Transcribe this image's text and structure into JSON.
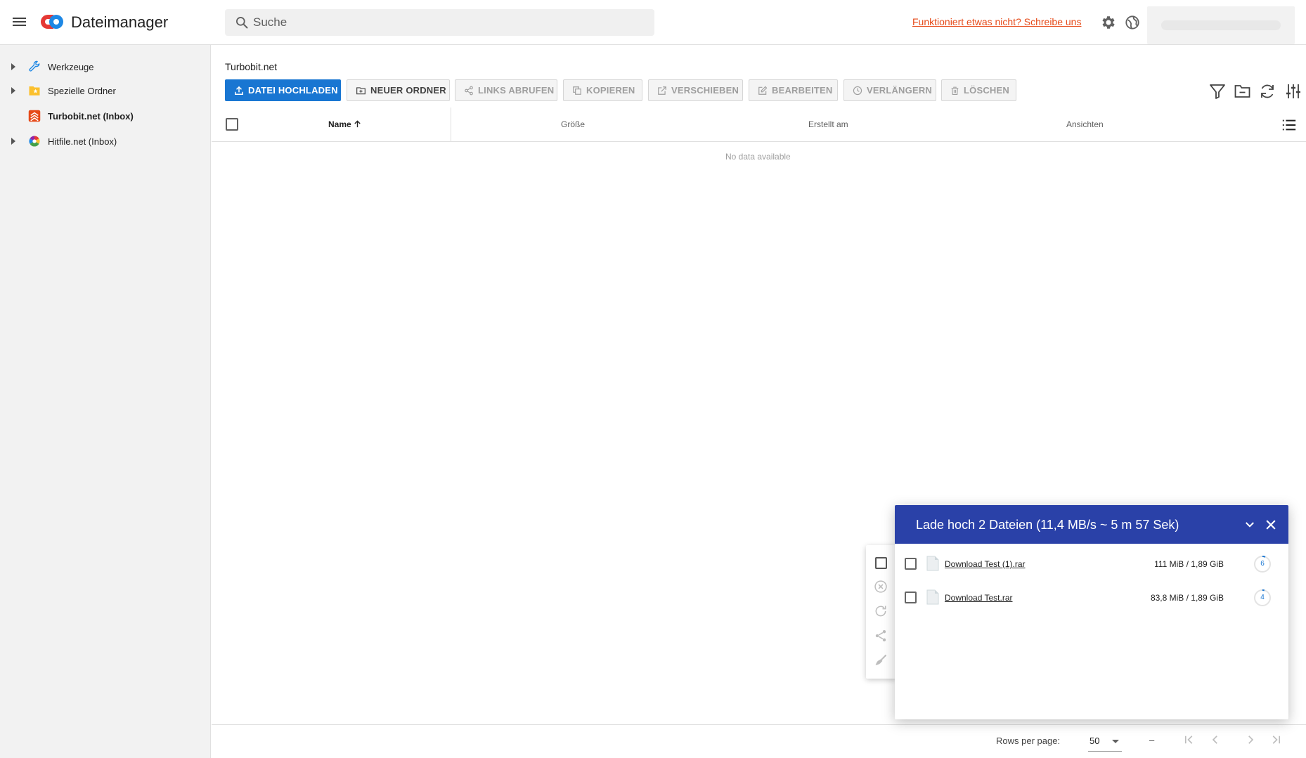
{
  "app": {
    "title": "Dateimanager",
    "menu_icon": "hamburger-menu-icon",
    "logo_colors": [
      "#e53935",
      "#1e88e5"
    ]
  },
  "header": {
    "search_placeholder": "Suche",
    "feedback_link": "Funktioniert etwas nicht? Schreibe uns",
    "feedback_color": "#e64a19"
  },
  "sidebar": {
    "items": [
      {
        "label": "Werkzeuge",
        "icon": "wrench-icon",
        "expandable": true
      },
      {
        "label": "Spezielle Ordner",
        "icon": "star-folder-icon",
        "expandable": true
      },
      {
        "label": "Turbobit.net (Inbox)",
        "icon": "turbobit-icon",
        "expandable": false,
        "selected": true
      },
      {
        "label": "Hitfile.net (Inbox)",
        "icon": "hitfile-icon",
        "expandable": true
      }
    ]
  },
  "main": {
    "breadcrumb": "Turbobit.net",
    "toolbar": {
      "upload": "DATEI HOCHLADEN",
      "new_folder": "NEUER ORDNER",
      "get_links": "LINKS ABRUFEN",
      "copy": "KOPIEREN",
      "move": "VERSCHIEBEN",
      "edit": "BEARBEITEN",
      "extend": "VERLÄNGERN",
      "delete": "LÖSCHEN"
    },
    "accent_color": "#1976d2",
    "table": {
      "columns": [
        "Name",
        "Größe",
        "Erstellt am",
        "Ansichten"
      ],
      "sort_column": "Name",
      "sort_direction": "asc",
      "empty_text": "No data available"
    },
    "pagination": {
      "rows_per_page_label": "Rows per page:",
      "rows_per_page": "50",
      "range": "–"
    }
  },
  "upload": {
    "title": "Lade hoch 2 Dateien (11,4 MB/s ~ 5 m 57 Sek)",
    "header_color": "#2a41a8",
    "files": [
      {
        "name": "Download Test (1).rar",
        "size": "111 MiB / 1,89 GiB",
        "progress": "6"
      },
      {
        "name": "Download Test.rar",
        "size": "83,8 MiB / 1,89 GiB",
        "progress": "4"
      }
    ]
  }
}
